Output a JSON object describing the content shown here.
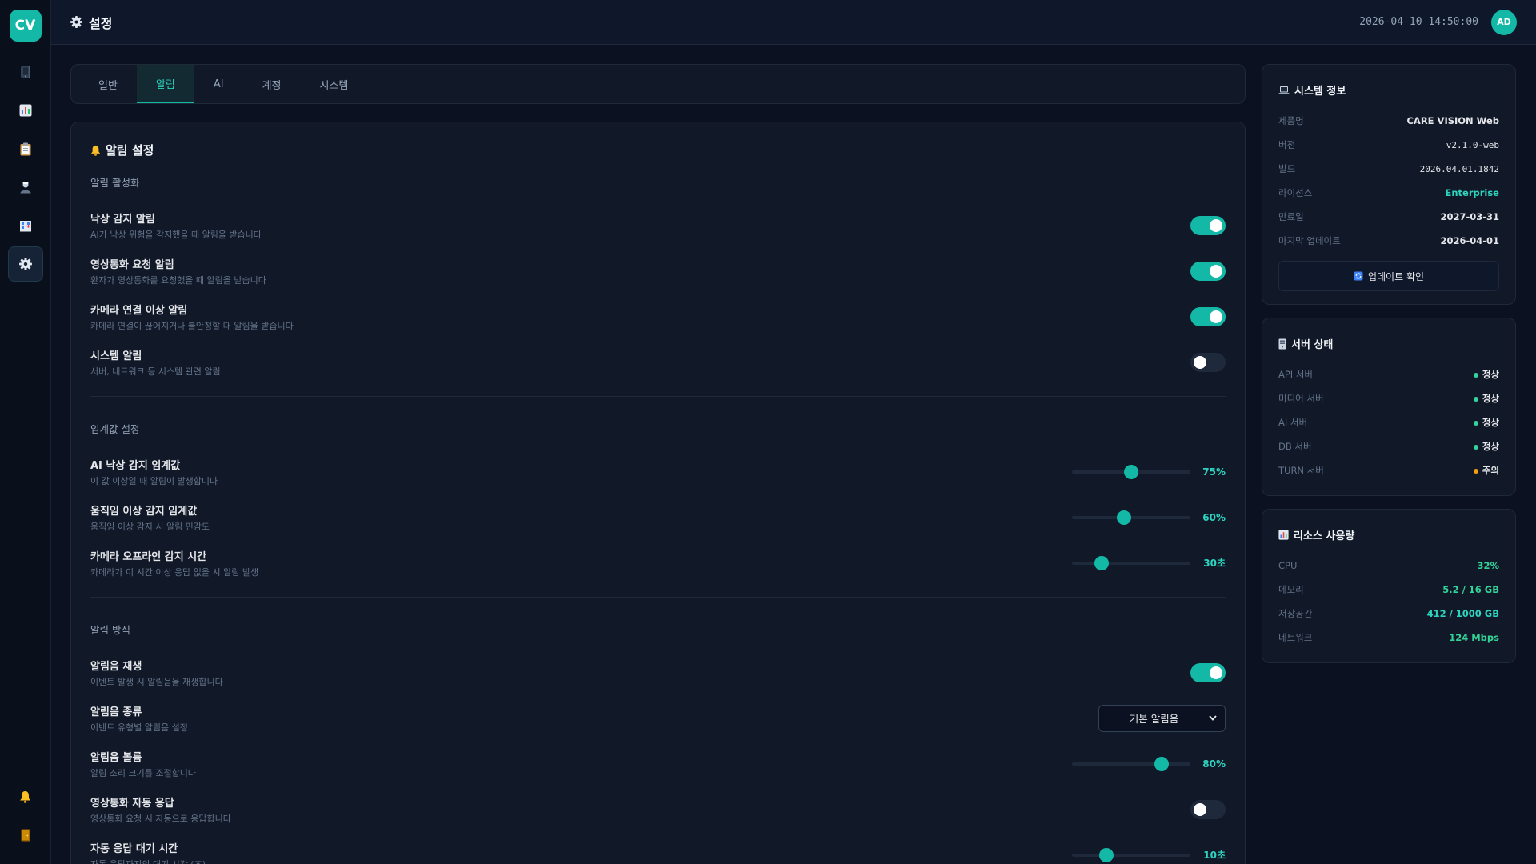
{
  "app": {
    "logo_text": "CV"
  },
  "sidebar": {
    "items": [
      {
        "icon": "mobile-icon",
        "active": false
      },
      {
        "icon": "chart-icon",
        "active": false
      },
      {
        "icon": "clipboard-icon",
        "active": false
      },
      {
        "icon": "user-icon",
        "active": false
      },
      {
        "icon": "hospital-icon",
        "active": false
      },
      {
        "icon": "gear-icon",
        "active": true
      }
    ],
    "bottom": [
      {
        "icon": "bell-icon"
      },
      {
        "icon": "door-icon"
      }
    ]
  },
  "header": {
    "title": "설정",
    "datetime": "2026-04-10 14:50:00",
    "avatar": "AD"
  },
  "tabs": [
    {
      "label": "일반",
      "active": false
    },
    {
      "label": "알림",
      "active": true
    },
    {
      "label": "AI",
      "active": false
    },
    {
      "label": "계정",
      "active": false
    },
    {
      "label": "시스템",
      "active": false
    }
  ],
  "alerts": {
    "title": "알림 설정",
    "activation": {
      "label": "알림 활성화",
      "items": [
        {
          "title": "낙상 감지 알림",
          "desc": "AI가 낙상 위험을 감지했을 때 알림을 받습니다",
          "on": true
        },
        {
          "title": "영상통화 요청 알림",
          "desc": "환자가 영상통화를 요청했을 때 알림을 받습니다",
          "on": true
        },
        {
          "title": "카메라 연결 이상 알림",
          "desc": "카메라 연결이 끊어지거나 불안정할 때 알림을 받습니다",
          "on": true
        },
        {
          "title": "시스템 알림",
          "desc": "서버, 네트워크 등 시스템 관련 알림",
          "on": false
        }
      ]
    },
    "threshold": {
      "label": "임계값 설정",
      "items": [
        {
          "title": "AI 낙상 감지 임계값",
          "desc": "이 값 이상일 때 알림이 발생합니다",
          "level": 0.5,
          "value": "75%"
        },
        {
          "title": "움직임 이상 감지 임계값",
          "desc": "움직임 이상 감지 시 알림 민감도",
          "level": 0.44,
          "value": "60%"
        },
        {
          "title": "카메라 오프라인 감지 시간",
          "desc": "카메라가 이 시간 이상 응답 없을 시 알림 발생",
          "level": 0.25,
          "value": "30초"
        }
      ]
    },
    "method": {
      "label": "알림 방식",
      "sound_play": {
        "title": "알림음 재생",
        "desc": "이벤트 발생 시 알림음을 재생합니다",
        "on": true
      },
      "sound_type": {
        "title": "알림음 종류",
        "desc": "이벤트 유형별 알림음 설정",
        "selected": "기본 알림음"
      },
      "volume": {
        "title": "알림음 볼륨",
        "desc": "알림 소리 크기를 조절합니다",
        "level": 0.76,
        "value": "80%"
      },
      "auto_answer": {
        "title": "영상통화 자동 응답",
        "desc": "영상통화 요청 시 자동으로 응답합니다",
        "on": false
      },
      "auto_wait": {
        "title": "자동 응답 대기 시간",
        "desc": "자동 응답까지의 대기 시간 (초)",
        "level": 0.29,
        "value": "10초"
      }
    }
  },
  "system_info": {
    "title": "시스템 정보",
    "rows": [
      {
        "key": "제품명",
        "value": "CARE VISION Web"
      },
      {
        "key": "버전",
        "value": "v2.1.0-web"
      },
      {
        "key": "빌드",
        "value": "2026.04.01.1842"
      },
      {
        "key": "라이선스",
        "value": "Enterprise"
      },
      {
        "key": "만료일",
        "value": "2027-03-31"
      },
      {
        "key": "마지막 업데이트",
        "value": "2026-04-01"
      }
    ],
    "update_button": "업데이트 확인"
  },
  "server_status": {
    "title": "서버 상태",
    "rows": [
      {
        "key": "API 서버",
        "value": "정상",
        "color": "#34d399"
      },
      {
        "key": "미디어 서버",
        "value": "정상",
        "color": "#34d399"
      },
      {
        "key": "AI 서버",
        "value": "정상",
        "color": "#34d399"
      },
      {
        "key": "DB 서버",
        "value": "정상",
        "color": "#34d399"
      },
      {
        "key": "TURN 서버",
        "value": "주의",
        "color": "#f59e0b"
      }
    ]
  },
  "resources": {
    "title": "리소스 사용량",
    "rows": [
      {
        "key": "CPU",
        "value": "32%"
      },
      {
        "key": "메모리",
        "value": "5.2 / 16 GB"
      },
      {
        "key": "저장공간",
        "value": "412 / 1000 GB"
      },
      {
        "key": "네트워크",
        "value": "124 Mbps"
      }
    ]
  },
  "colors": {
    "accent": "#14b8a6",
    "ok": "#34d399",
    "warn": "#f59e0b",
    "bg": "#0b1120"
  }
}
